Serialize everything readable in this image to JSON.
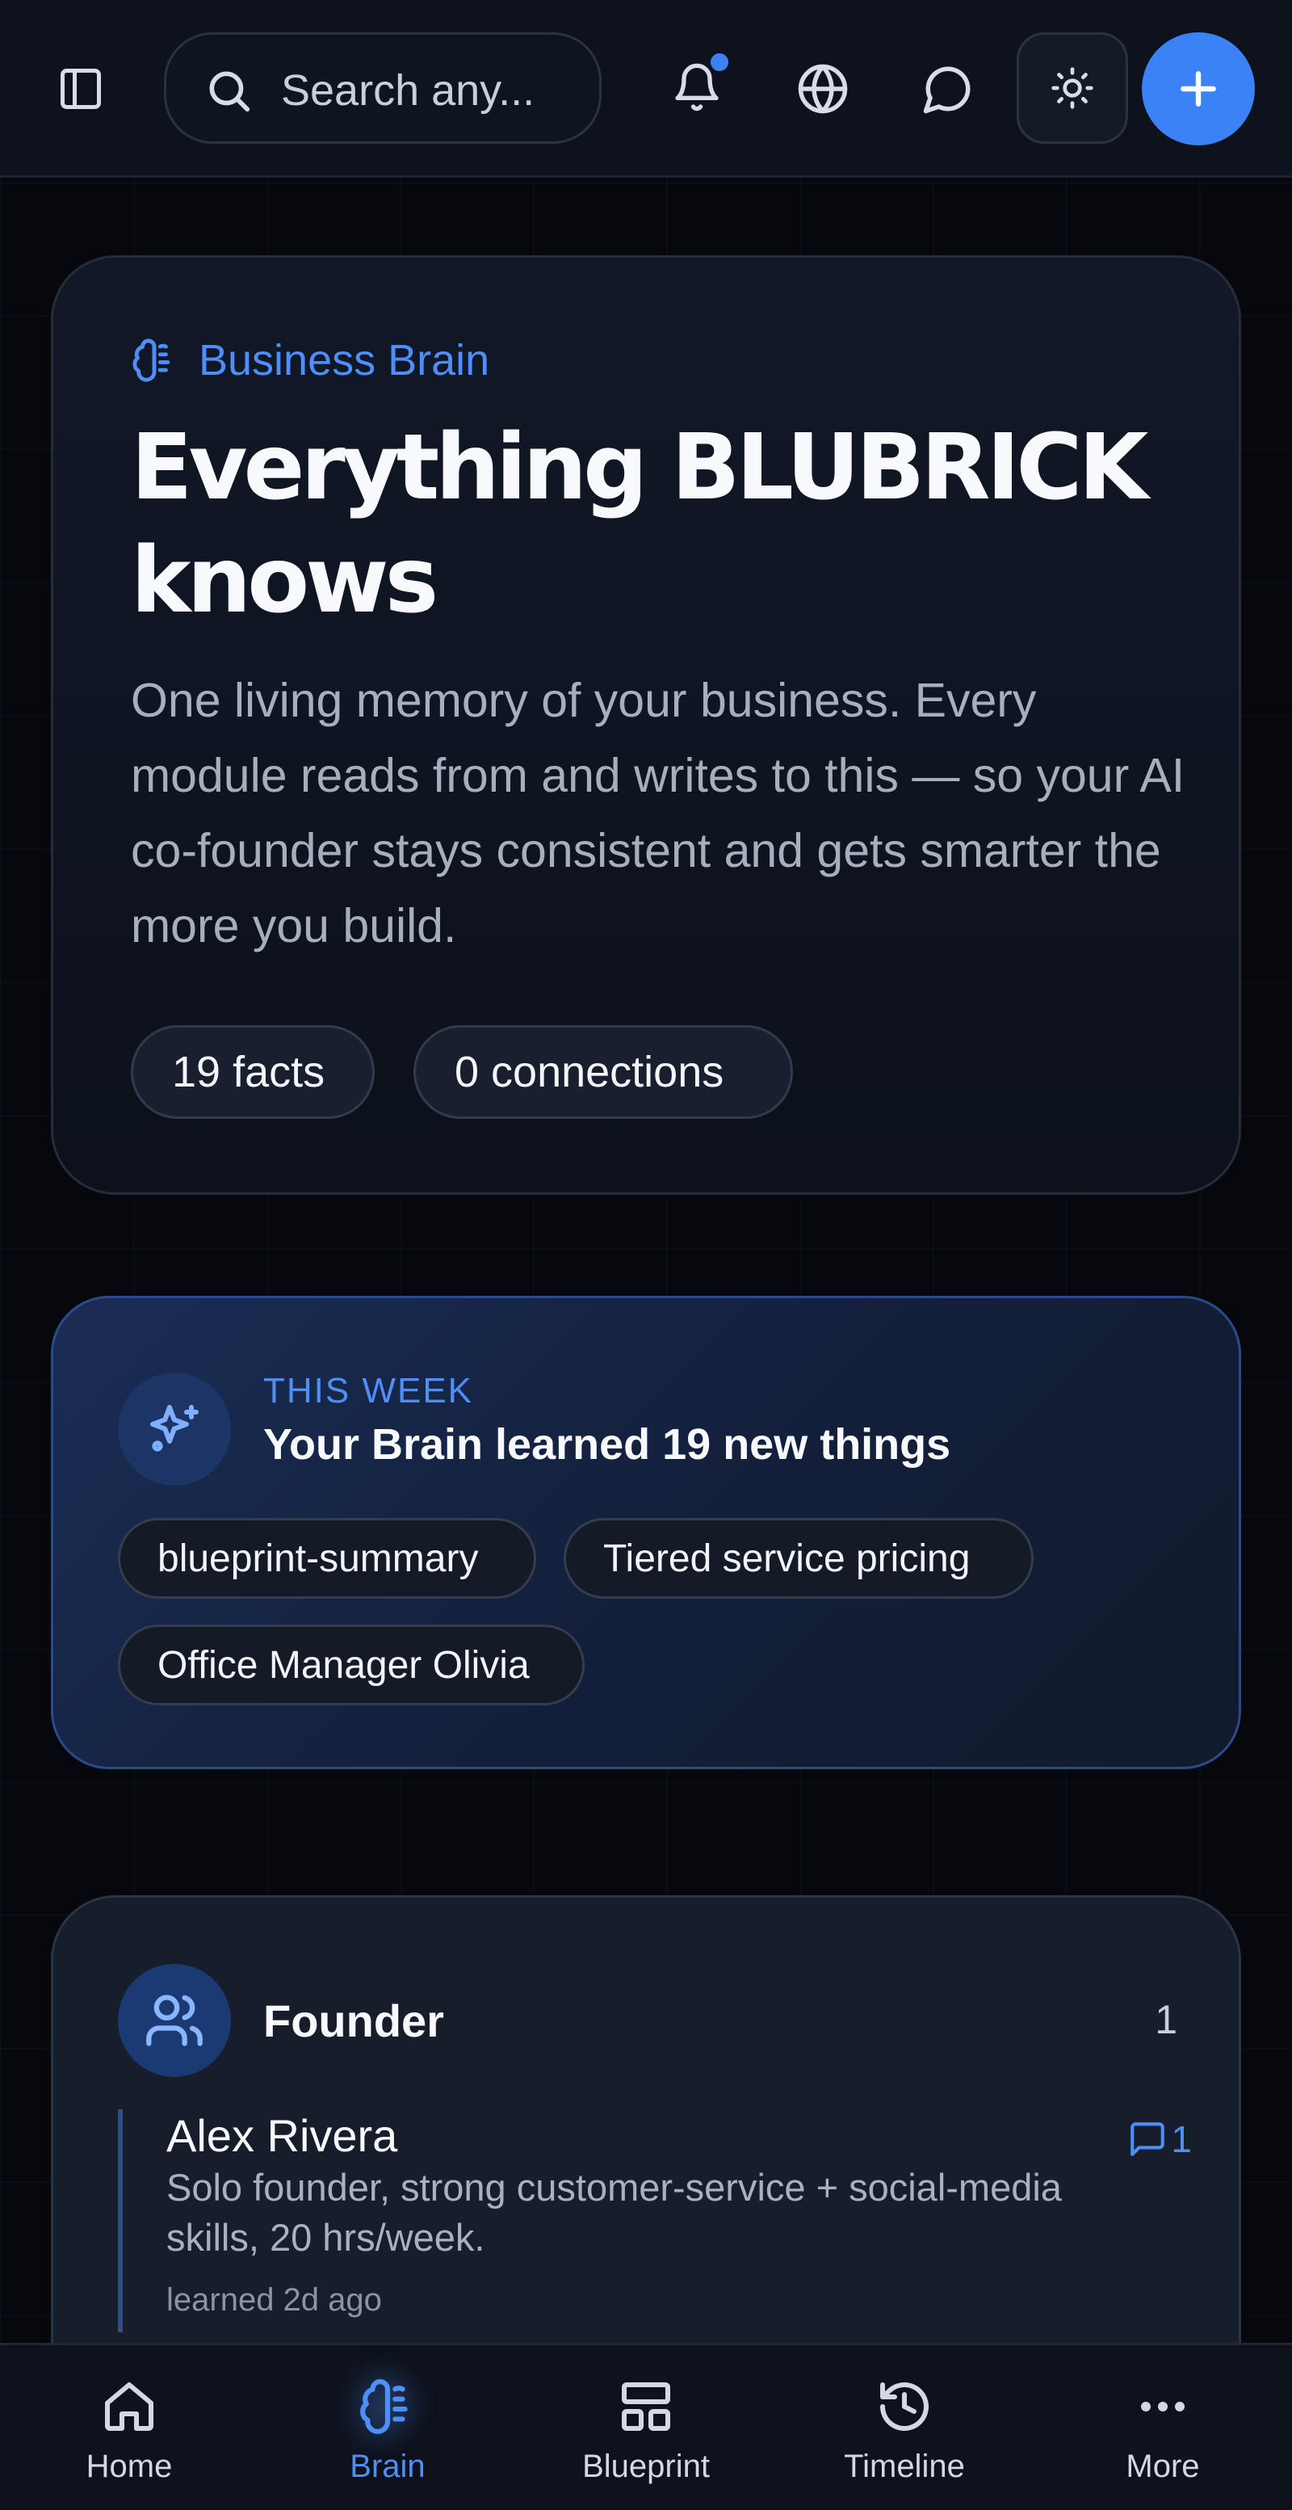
{
  "header": {
    "search_placeholder": "Search any...",
    "icons": [
      "sidebar-toggle-icon",
      "search-icon",
      "bell-icon",
      "globe-icon",
      "chat-icon",
      "sun-icon",
      "plus-icon"
    ],
    "has_notification": true
  },
  "hero": {
    "eyebrow": "Business Brain",
    "title": "Everything BLUBRICK knows",
    "description": "One living memory of your business. Every module reads from and writes to this — so your AI co-founder stays consistent and gets smarter the more you build.",
    "facts_label": "19 facts",
    "connections_label": "0 connections"
  },
  "this_week": {
    "eyebrow": "THIS WEEK",
    "title": "Your Brain learned 19 new things",
    "tags": [
      "blueprint-summary",
      "Tiered service pricing",
      "Office Manager Olivia"
    ]
  },
  "founder_section": {
    "title": "Founder",
    "count": "1",
    "entry": {
      "name": "Alex Rivera",
      "description": "Solo founder, strong customer-service + social-media skills, 20 hrs/week.",
      "time": "learned 2d ago",
      "comment_count": "1"
    }
  },
  "bottom_nav": {
    "items": [
      {
        "label": "Home",
        "icon": "home-icon"
      },
      {
        "label": "Brain",
        "icon": "brain-icon",
        "active": true
      },
      {
        "label": "Blueprint",
        "icon": "blueprint-icon"
      },
      {
        "label": "Timeline",
        "icon": "history-icon"
      },
      {
        "label": "More",
        "icon": "more-icon"
      }
    ]
  },
  "colors": {
    "accent": "#3b82f6",
    "background": "#06080d",
    "card": "#111827"
  }
}
